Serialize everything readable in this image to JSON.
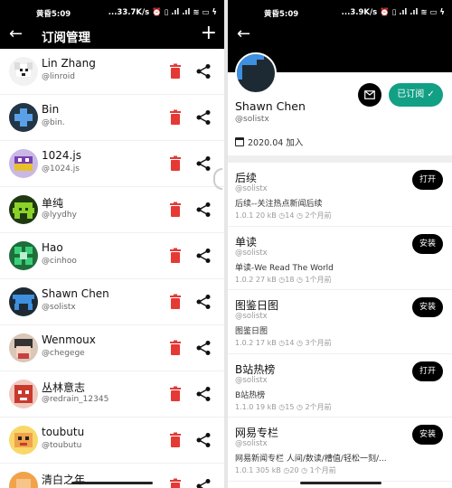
{
  "left": {
    "status": {
      "time": "黄昏5:09",
      "stats": "...33.7K/s ⏰ ▯ .ıl .ıl ≋ ▭ ϟ"
    },
    "title": "订阅管理",
    "users": [
      {
        "name": "Lin Zhang",
        "handle": "@linroid",
        "avatar": "dog"
      },
      {
        "name": "Bin",
        "handle": "@bin.",
        "avatar": "blue-cross"
      },
      {
        "name": "1024.js",
        "handle": "@1024.js",
        "avatar": "purple-yellow"
      },
      {
        "name": "单纯",
        "handle": "@lyydhy",
        "avatar": "green-invader"
      },
      {
        "name": "Hao",
        "handle": "@cinhoo",
        "avatar": "green-blocks"
      },
      {
        "name": "Shawn Chen",
        "handle": "@solistx",
        "avatar": "blue-arch"
      },
      {
        "name": "Wenmoux",
        "handle": "@chegege",
        "avatar": "photo"
      },
      {
        "name": "丛林意志",
        "handle": "@redrain_12345",
        "avatar": "red-pixel"
      },
      {
        "name": "toubutu",
        "handle": "@toubutu",
        "avatar": "cartoon"
      },
      {
        "name": "清白之年",
        "handle": "",
        "avatar": "orange"
      }
    ]
  },
  "right": {
    "status": {
      "time": "黄昏5:09",
      "stats": "...3.9K/s ⏰ ▯ .ıl .ıl ≋ ▭ ϟ"
    },
    "profile": {
      "name": "Shawn Chen",
      "handle": "@solistx",
      "subscribed_label": "已订阅 ✓",
      "joined": "2020.04 加入"
    },
    "plugins": [
      {
        "title": "后续",
        "author": "@solistx",
        "desc": "后续--关注热点新闻后续",
        "meta": "1.0.1  20 kB  ◷14  ◷ 2个月前",
        "action": "打开"
      },
      {
        "title": "单读",
        "author": "@solistx",
        "desc": "单读-We Read The World",
        "meta": "1.0.2  27 kB  ◷18  ◷ 1个月前",
        "action": "安装"
      },
      {
        "title": "图鉴日图",
        "author": "@solistx",
        "desc": "图鉴日图",
        "meta": "1.0.2  17 kB  ◷14  ◷ 3个月前",
        "action": "安装"
      },
      {
        "title": "B站热榜",
        "author": "@solistx",
        "desc": "B站热榜",
        "meta": "1.1.0  19 kB  ◷15  ◷ 2个月前",
        "action": "打开"
      },
      {
        "title": "网易专栏",
        "author": "@solistx",
        "desc": "网易新闻专栏 人间/数读/槽值/轻松一刻/...",
        "meta": "1.0.1  305 kB  ◷20  ◷ 1个月前",
        "action": "安装"
      }
    ]
  },
  "colors": {
    "accent_green": "#12a085",
    "delete_red": "#e53935"
  }
}
